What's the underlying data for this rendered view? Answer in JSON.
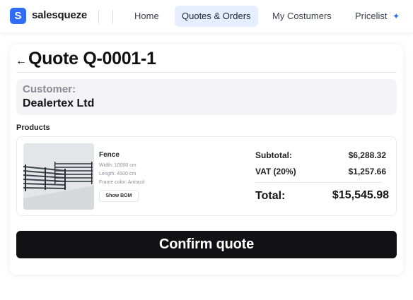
{
  "nav": {
    "logo_letter": "S",
    "brand": "salesqueze",
    "items": [
      {
        "label": "Home",
        "active": false
      },
      {
        "label": "Quotes & Orders",
        "active": true
      },
      {
        "label": "My Costumers",
        "active": false
      },
      {
        "label": "Pricelist",
        "active": false
      }
    ],
    "pricelist_icon": "sparkle-icon"
  },
  "quote": {
    "back_icon": "arrow-left-icon",
    "title": "Quote Q-0001-1",
    "customer_label": "Customer:",
    "customer_name": "Dealertex Ltd",
    "products_label": "Products",
    "product": {
      "name": "Fence",
      "width": "Width: 10000 cm",
      "length": "Length: 4500 cm",
      "frame_color": "Frame color: Antracit",
      "bom_label": "Show BOM"
    },
    "totals": {
      "subtotal_label": "Subtotal:",
      "subtotal_value": "$6,288.32",
      "vat_label": "VAT (20%)",
      "vat_value": "$1,257.66",
      "total_label": "Total:",
      "total_value": "$15,545.98"
    },
    "confirm_label": "Confirm quote"
  },
  "colors": {
    "accent": "#2f6df6",
    "active_tab": "#e6efff",
    "confirm_button": "#121214"
  }
}
